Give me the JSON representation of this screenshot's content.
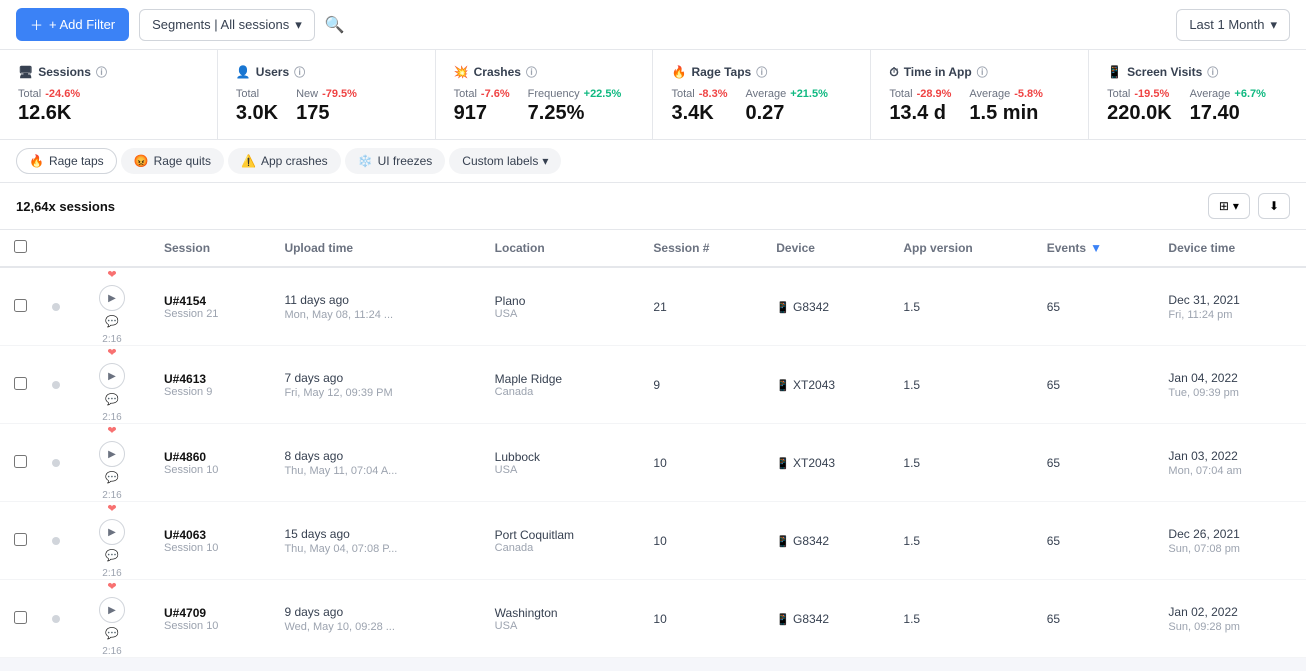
{
  "topbar": {
    "add_filter": "+ Add Filter",
    "segments_label": "Segments | All sessions",
    "last_month": "Last 1 Month"
  },
  "metrics": [
    {
      "title": "Sessions",
      "groups": [
        {
          "label": "Total",
          "pct": "-24.6%",
          "pct_type": "neg",
          "value": "12.6K"
        }
      ]
    },
    {
      "title": "Users",
      "groups": [
        {
          "label": "Total",
          "pct": null,
          "pct_type": null,
          "value": "3.0K"
        },
        {
          "label": "New",
          "pct": "-79.5%",
          "pct_type": "neg",
          "value": "175"
        }
      ]
    },
    {
      "title": "Crashes",
      "groups": [
        {
          "label": "Total",
          "pct": "-7.6%",
          "pct_type": "neg",
          "value": "917"
        },
        {
          "label": "Frequency",
          "pct": "+22.5%",
          "pct_type": "pos",
          "value": "7.25%"
        }
      ]
    },
    {
      "title": "Rage Taps",
      "groups": [
        {
          "label": "Total",
          "pct": "-8.3%",
          "pct_type": "neg",
          "value": "3.4K"
        },
        {
          "label": "Average",
          "pct": "+21.5%",
          "pct_type": "pos",
          "value": "0.27"
        }
      ]
    },
    {
      "title": "Time in App",
      "groups": [
        {
          "label": "Total",
          "pct": "-28.9%",
          "pct_type": "neg",
          "value": "13.4 d"
        },
        {
          "label": "Average",
          "pct": "-5.8%",
          "pct_type": "neg",
          "value": "1.5 min"
        }
      ]
    },
    {
      "title": "Screen Visits",
      "groups": [
        {
          "label": "Total",
          "pct": "-19.5%",
          "pct_type": "neg",
          "value": "220.0K"
        },
        {
          "label": "Average",
          "pct": "+6.7%",
          "pct_type": "pos",
          "value": "17.40"
        }
      ]
    }
  ],
  "filter_tabs": [
    {
      "label": "Rage taps",
      "icon": "🔥",
      "active": true
    },
    {
      "label": "Rage quits",
      "icon": "😡",
      "active": false
    },
    {
      "label": "App crashes",
      "icon": "⚠️",
      "active": false
    },
    {
      "label": "UI freezes",
      "icon": "❄️",
      "active": false
    }
  ],
  "custom_labels": "Custom labels",
  "sessions_count": "12,64x sessions",
  "table": {
    "columns": [
      "",
      "",
      "",
      "Session",
      "Upload time",
      "Location",
      "Session #",
      "Device",
      "App version",
      "Events",
      "Device time"
    ],
    "rows": [
      {
        "id": "U#4154",
        "session_num": "Session 21",
        "duration": "2:16",
        "upload_main": "11 days ago",
        "upload_sub": "Mon, May 08, 11:24 ...",
        "location_city": "Plano",
        "location_country": "USA",
        "session_hash": "21",
        "device": "G8342",
        "app_version": "1.5",
        "events": "65",
        "device_time_main": "Dec 31, 2021",
        "device_time_sub": "Fri, 11:24 pm"
      },
      {
        "id": "U#4613",
        "session_num": "Session 9",
        "duration": "2:16",
        "upload_main": "7 days ago",
        "upload_sub": "Fri, May 12, 09:39 PM",
        "location_city": "Maple Ridge",
        "location_country": "Canada",
        "session_hash": "9",
        "device": "XT2043",
        "app_version": "1.5",
        "events": "65",
        "device_time_main": "Jan 04, 2022",
        "device_time_sub": "Tue, 09:39 pm"
      },
      {
        "id": "U#4860",
        "session_num": "Session 10",
        "duration": "2:16",
        "upload_main": "8 days ago",
        "upload_sub": "Thu, May 11, 07:04 A...",
        "location_city": "Lubbock",
        "location_country": "USA",
        "session_hash": "10",
        "device": "XT2043",
        "app_version": "1.5",
        "events": "65",
        "device_time_main": "Jan 03, 2022",
        "device_time_sub": "Mon, 07:04 am"
      },
      {
        "id": "U#4063",
        "session_num": "Session 10",
        "duration": "2:16",
        "upload_main": "15 days ago",
        "upload_sub": "Thu, May 04, 07:08 P...",
        "location_city": "Port Coquitlam",
        "location_country": "Canada",
        "session_hash": "10",
        "device": "G8342",
        "app_version": "1.5",
        "events": "65",
        "device_time_main": "Dec 26, 2021",
        "device_time_sub": "Sun, 07:08 pm"
      },
      {
        "id": "U#4709",
        "session_num": "Session 10",
        "duration": "2:16",
        "upload_main": "9 days ago",
        "upload_sub": "Wed, May 10, 09:28 ...",
        "location_city": "Washington",
        "location_country": "USA",
        "session_hash": "10",
        "device": "G8342",
        "app_version": "1.5",
        "events": "65",
        "device_time_main": "Jan 02, 2022",
        "device_time_sub": "Sun, 09:28 pm"
      }
    ]
  }
}
